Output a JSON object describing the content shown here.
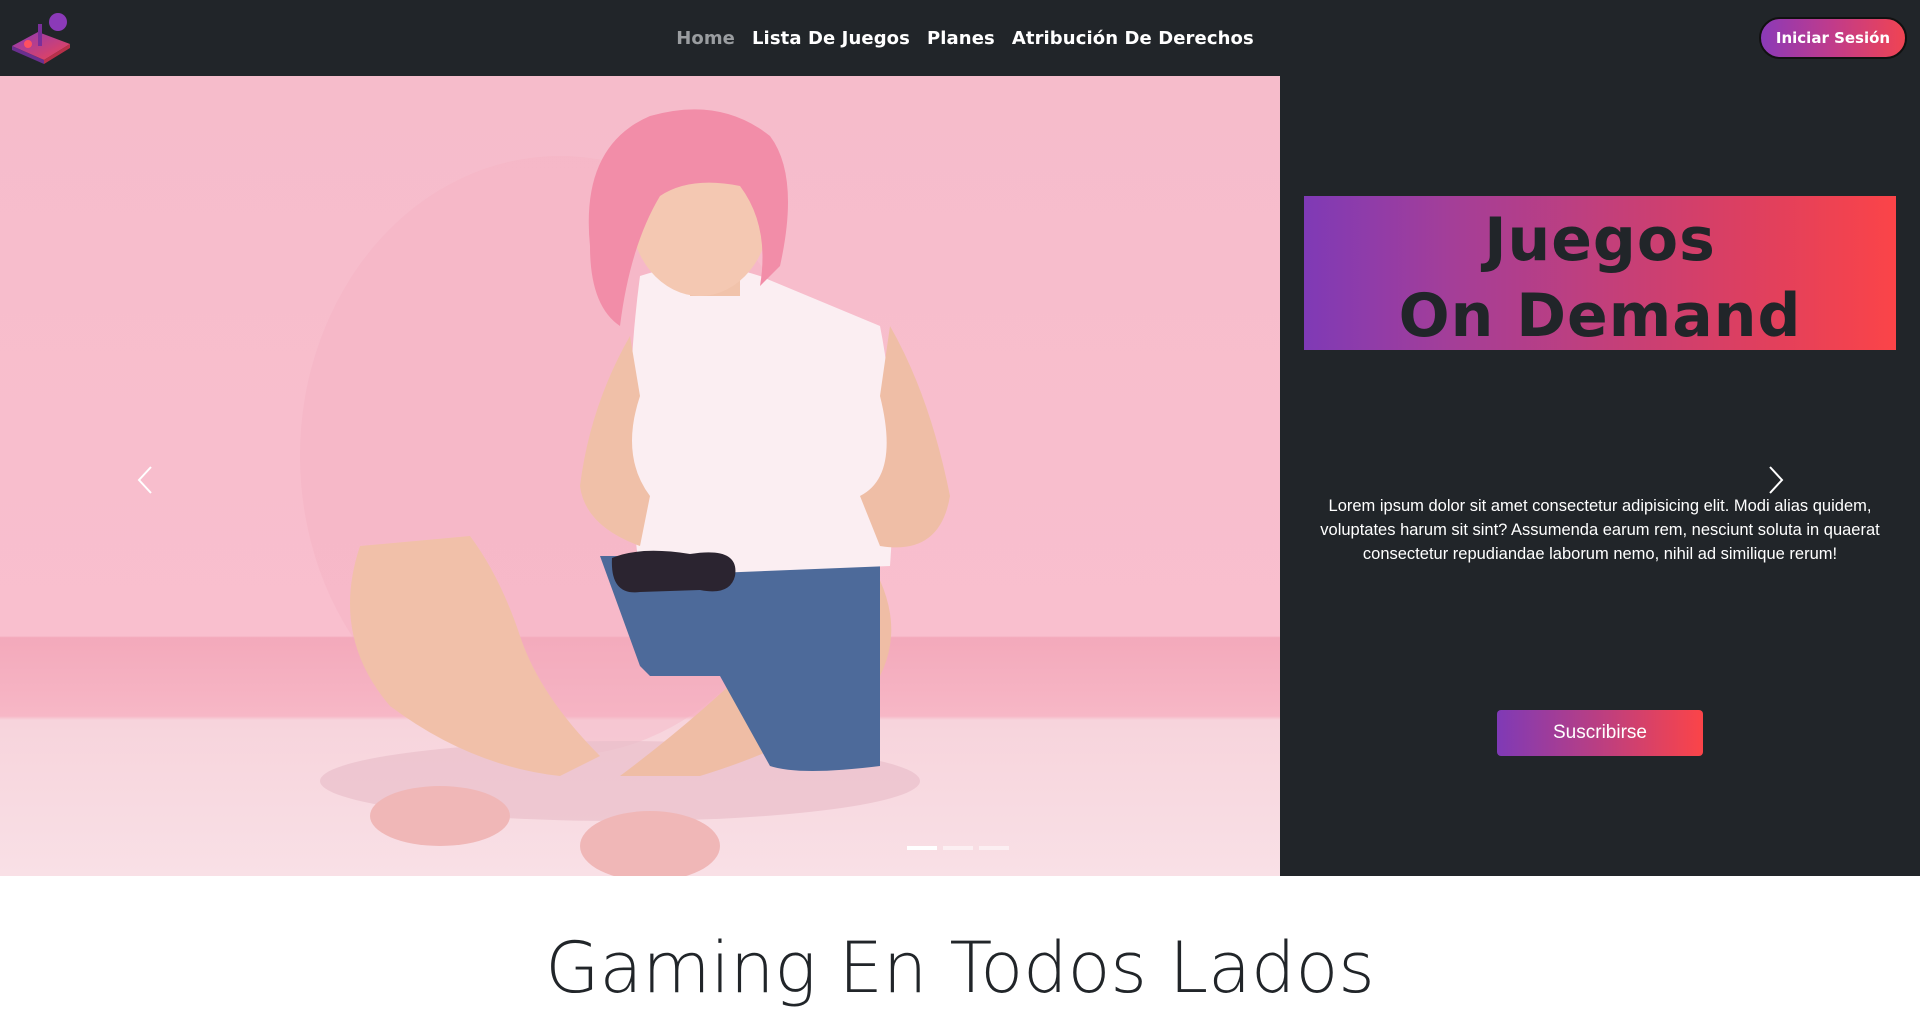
{
  "navbar": {
    "logo_icon": "joystick-logo-icon",
    "links": [
      {
        "label": "Home",
        "active": true
      },
      {
        "label": "Lista De Juegos",
        "active": false
      },
      {
        "label": "Planes",
        "active": false
      },
      {
        "label": "Atribución De Derechos",
        "active": false
      }
    ],
    "login_label": "Iniciar Sesión"
  },
  "hero": {
    "title_line1": "Juegos",
    "title_line2": "On Demand",
    "description": "Lorem ipsum dolor sit amet consectetur adipisicing elit. Modi alias quidem, voluptates harum sit sint? Assumenda earum rem, nesciunt soluta in quaerat consectetur repudiandae laborum nemo, nihil ad similique rerum!",
    "subscribe_label": "Suscribirse",
    "prev_icon": "chevron-left-icon",
    "next_icon": "chevron-right-icon",
    "image": "girl-with-gamepad-photo",
    "indicators": 3,
    "active_indicator": 0
  },
  "section": {
    "title": "Gaming En Todos Lados"
  },
  "colors": {
    "navbar_bg": "#212529",
    "gradient_start": "#7f3ab6",
    "gradient_end": "#fb4448",
    "photo_bg": "#f9bfce"
  }
}
